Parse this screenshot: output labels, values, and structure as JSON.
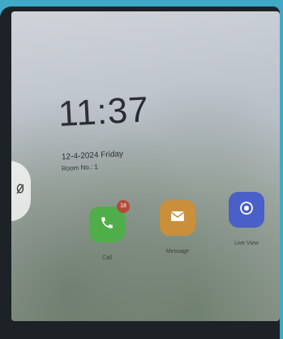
{
  "clock": {
    "time": "11:37",
    "date": "12-4-2024  Friday",
    "room": "Room No.: 1"
  },
  "side_tab": {
    "icon": "mic-off-icon"
  },
  "apps": [
    {
      "label": "Call",
      "icon": "phone-icon",
      "badge": "18",
      "color": "#4fae4a"
    },
    {
      "label": "Message",
      "icon": "envelope-icon",
      "color": "#c98f3b"
    },
    {
      "label": "Live View",
      "icon": "record-icon",
      "color": "#4a5fc8"
    }
  ]
}
